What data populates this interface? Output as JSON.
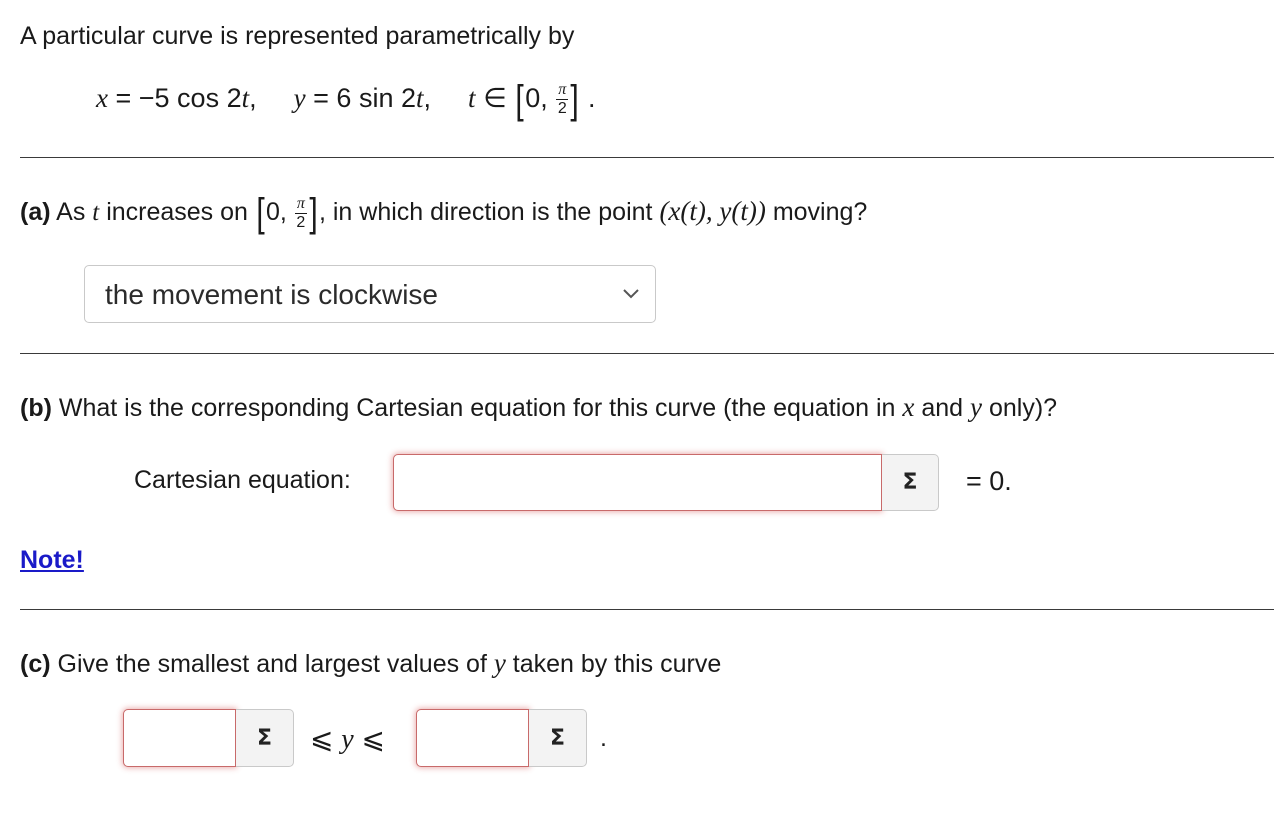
{
  "intro": {
    "text": "A particular curve is represented parametrically by",
    "eq_x_lhs": "x",
    "eq_x_rhs": "= −5 cos 2",
    "eq_y_lhs": "y",
    "eq_y_rhs": "= 6 sin 2",
    "t": "t",
    "comma": ",",
    "in": "∈",
    "interval_start": "0,",
    "pi": "π",
    "two": "2",
    "period": "."
  },
  "part_a": {
    "label": "(a)",
    "text_before": "As",
    "t": "t",
    "text_mid": "increases on",
    "interval_start": "0,",
    "pi": "π",
    "two": "2",
    "text_after": ", in which direction is the point",
    "point": "(x(t), y(t))",
    "text_end": "moving?",
    "select_value": "the movement is clockwise"
  },
  "part_b": {
    "label": "(b)",
    "text_before": "What is the corresponding Cartesian equation for this curve (the equation in",
    "x": "x",
    "and": "and",
    "y": "y",
    "text_after": "only)?",
    "field_label": "Cartesian equation:",
    "field_value": "",
    "sigma": "Σ",
    "equals_zero": "= 0."
  },
  "note": {
    "label": "Note!"
  },
  "part_c": {
    "label": "(c)",
    "text_before": "Give the smallest and largest values of",
    "y": "y",
    "text_after": "taken by this curve",
    "min_value": "",
    "max_value": "",
    "sigma": "Σ",
    "leq": "⩽",
    "y_var": "y",
    "period": "."
  },
  "colors": {
    "link": "#1a1ac8",
    "invalid_border": "#c86a6a",
    "select_border": "#c9c9c9"
  },
  "icons": {
    "dropdown": "chevron-down-icon",
    "equation_editor": "sigma-icon"
  }
}
